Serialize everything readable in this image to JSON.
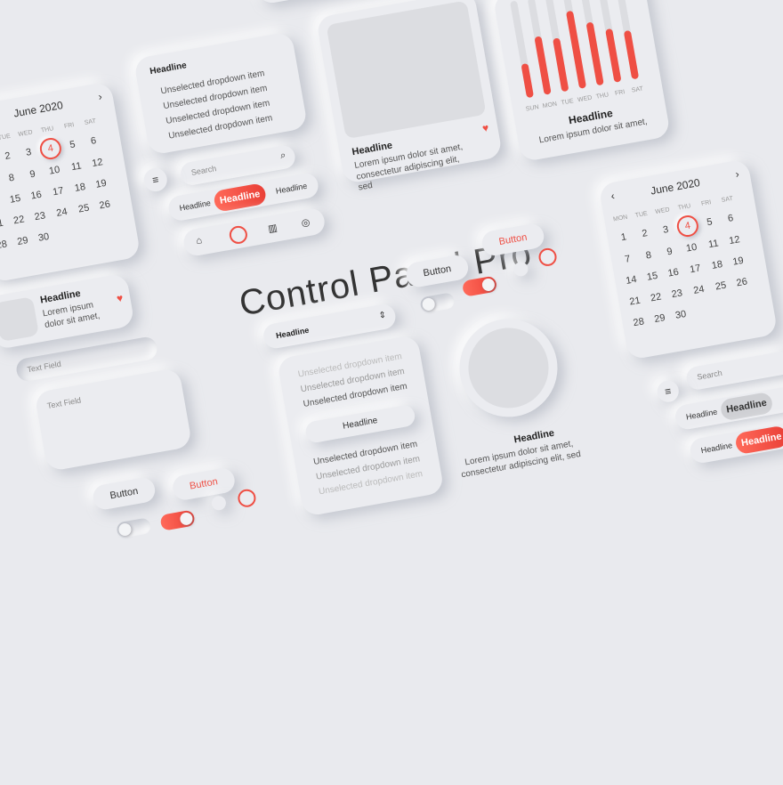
{
  "title": "Control Panel Pro",
  "accent": "#ef4f44",
  "background": "#e9eaee",
  "calendar": {
    "month": "June 2020",
    "next_icon": "chevron-right-icon",
    "prev_icon": "chevron-left-icon",
    "weekdays": [
      "MON",
      "TUE",
      "WED",
      "THU",
      "FRI",
      "SAT"
    ],
    "rows": [
      [
        "",
        "",
        "",
        "",
        "",
        ""
      ],
      [
        "1",
        "2",
        "3",
        "4",
        "5",
        "6"
      ],
      [
        "7",
        "8",
        "9",
        "10",
        "11",
        "12",
        "13"
      ],
      [
        "14",
        "15",
        "16",
        "17",
        "18",
        "19",
        "20"
      ],
      [
        "21",
        "22",
        "23",
        "24",
        "25",
        "26",
        "27"
      ],
      [
        "28",
        "29",
        "30"
      ]
    ],
    "today": "4"
  },
  "dropdown": {
    "headline": "Headline",
    "items": [
      "Unselected dropdown item",
      "Unselected dropdown item",
      "Unselected dropdown item",
      "Unselected dropdown item"
    ]
  },
  "scroll_list": {
    "items_top": [
      "Unselected dropdown item",
      "Unselected dropdown item",
      "Unselected dropdown item"
    ],
    "selected": "Headline",
    "items_bottom": [
      "Unselected dropdown item",
      "Unselected dropdown item",
      "Unselected dropdown item"
    ]
  },
  "card_small": {
    "headline": "Headline",
    "body": "Lorem ipsum dolor sit amet,"
  },
  "card_large": {
    "headline": "Headline",
    "body": "Lorem ipsum dolor sit amet, consectetur adipiscing elit, sed"
  },
  "card_round": {
    "headline": "Headline",
    "body": "Lorem ipsum dolor sit amet, consectetur adipiscing elit, sed"
  },
  "chart_card": {
    "headline": "Headline",
    "body": "Lorem ipsum dolor sit amet,"
  },
  "chart_data": {
    "type": "bar",
    "categories": [
      "SUN",
      "MON",
      "TUE",
      "WED",
      "THU",
      "FRI",
      "SAT"
    ],
    "values": [
      0.35,
      0.6,
      0.55,
      0.8,
      0.65,
      0.55,
      0.5
    ],
    "ylim": [
      0,
      1
    ]
  },
  "search": {
    "placeholder": "Search"
  },
  "text_field": {
    "label": "Text Field"
  },
  "tabs": {
    "left": "Headline",
    "active": "Headline",
    "right": "Headline",
    "cut": "Hea"
  },
  "buttons": {
    "primary": "Button",
    "secondary": "Button"
  },
  "select_headline": "Headline",
  "icons": [
    "home-icon",
    "compass-icon",
    "chart-icon",
    "globe-icon",
    "heart-icon",
    "menu-icon",
    "search-icon"
  ]
}
